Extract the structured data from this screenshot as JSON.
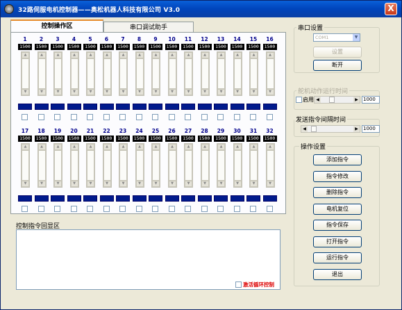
{
  "window": {
    "title": "32路伺服电机控制器——奥松机器人科技有限公司 V3.0",
    "close_glyph": "X"
  },
  "tabs": [
    {
      "label": "控制操作区",
      "active": true
    },
    {
      "label": "串口调试助手",
      "active": false
    }
  ],
  "servos_row1": [
    {
      "n": "1",
      "v": "1500"
    },
    {
      "n": "2",
      "v": "1500"
    },
    {
      "n": "3",
      "v": "1500"
    },
    {
      "n": "4",
      "v": "1500"
    },
    {
      "n": "5",
      "v": "1500"
    },
    {
      "n": "6",
      "v": "1500"
    },
    {
      "n": "7",
      "v": "1500"
    },
    {
      "n": "8",
      "v": "1500"
    },
    {
      "n": "9",
      "v": "1500"
    },
    {
      "n": "10",
      "v": "1500"
    },
    {
      "n": "11",
      "v": "1500"
    },
    {
      "n": "12",
      "v": "1500"
    },
    {
      "n": "13",
      "v": "1500"
    },
    {
      "n": "14",
      "v": "1500"
    },
    {
      "n": "15",
      "v": "1500"
    },
    {
      "n": "16",
      "v": "1500"
    }
  ],
  "servos_row2": [
    {
      "n": "17",
      "v": "1500"
    },
    {
      "n": "18",
      "v": "1500"
    },
    {
      "n": "19",
      "v": "1500"
    },
    {
      "n": "20",
      "v": "1500"
    },
    {
      "n": "21",
      "v": "1500"
    },
    {
      "n": "22",
      "v": "1500"
    },
    {
      "n": "23",
      "v": "1500"
    },
    {
      "n": "24",
      "v": "1500"
    },
    {
      "n": "25",
      "v": "1500"
    },
    {
      "n": "26",
      "v": "1500"
    },
    {
      "n": "27",
      "v": "1500"
    },
    {
      "n": "28",
      "v": "1500"
    },
    {
      "n": "29",
      "v": "1500"
    },
    {
      "n": "30",
      "v": "1500"
    },
    {
      "n": "31",
      "v": "1500"
    },
    {
      "n": "32",
      "v": "1500"
    }
  ],
  "feedback": {
    "label": "控制指令回显区",
    "loop_label": "激活循环控制",
    "loop_checked": false
  },
  "serial": {
    "group_label": "串口设置",
    "port_value": "COM1",
    "set_label": "设置",
    "disconnect_label": "断开"
  },
  "servo_timing": {
    "group_label": "舵机动作运行时间",
    "enable_label": "启用",
    "enabled": false,
    "value": "1000",
    "slider_fraction": 0.3
  },
  "send_interval": {
    "group_label": "发送指令间隔时间",
    "value": "1000",
    "slider_fraction": 0.08
  },
  "operations": {
    "group_label": "操作设置",
    "buttons": [
      "添加指令",
      "指令修改",
      "删除指令",
      "电机复位",
      "指令保存",
      "打开指令",
      "运行指令",
      "退出"
    ]
  },
  "colors": {
    "title_bar": "#0a5fd8",
    "value_bar": "#001a8c",
    "loop_label": "#dd0000"
  }
}
